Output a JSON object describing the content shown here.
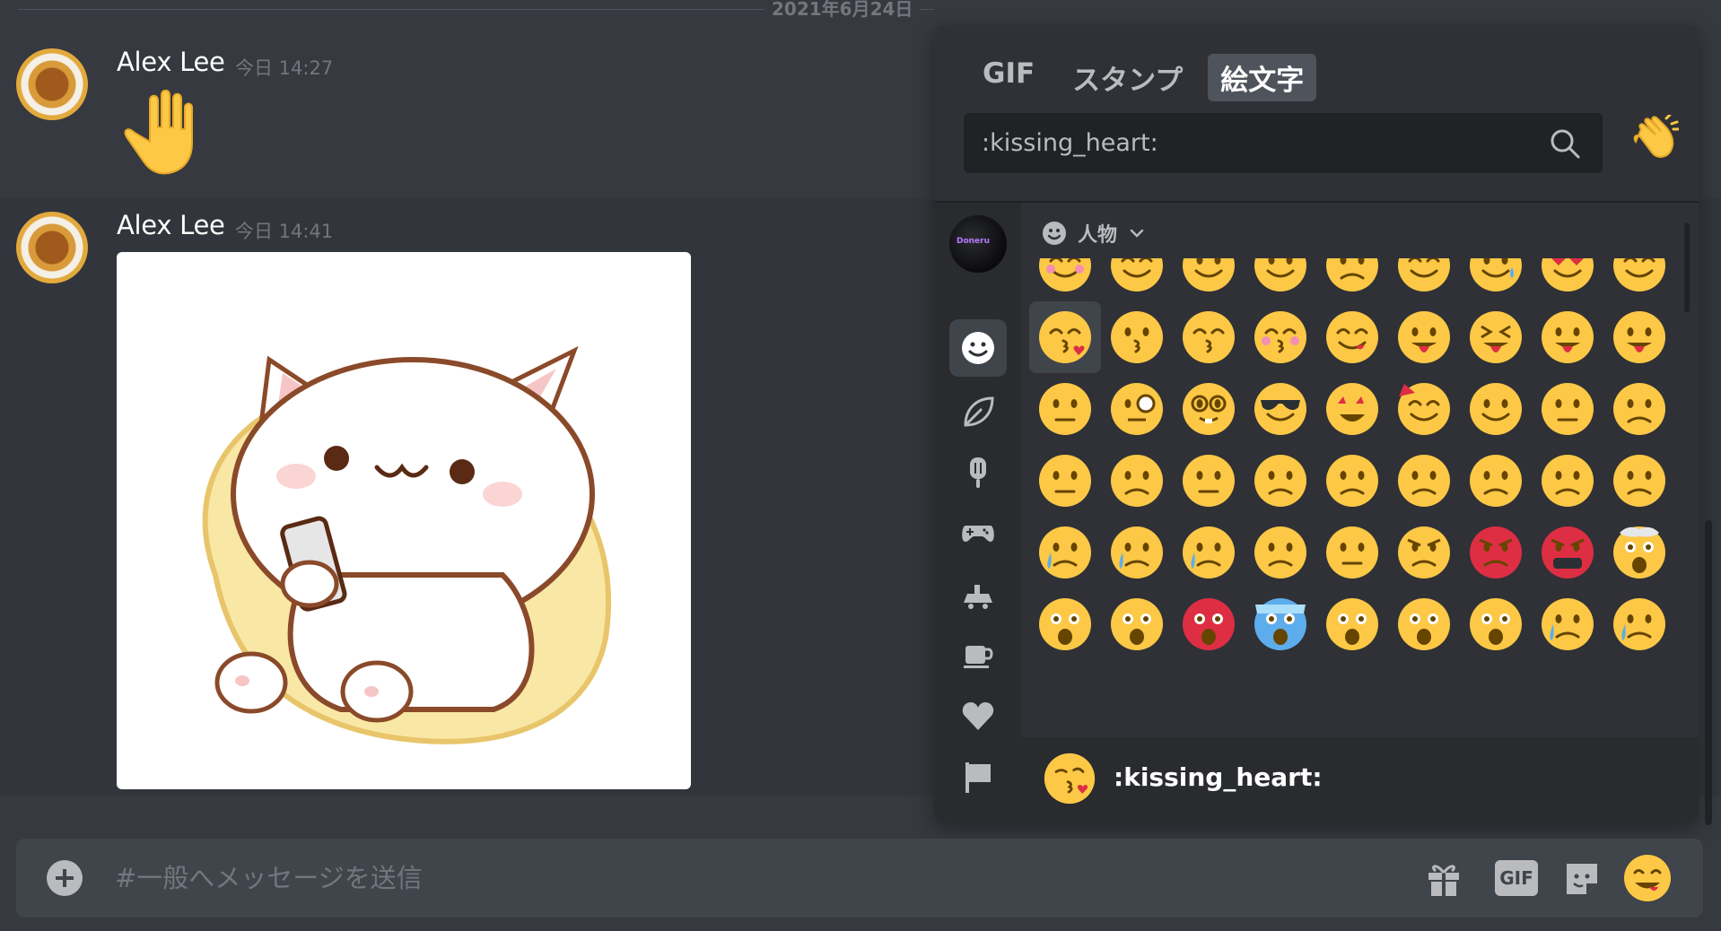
{
  "date_divider": "2021年6月24日",
  "messages": [
    {
      "author": "Alex Lee",
      "timestamp": "今日 14:27",
      "content": "wave-emoji"
    },
    {
      "author": "Alex Lee",
      "timestamp": "今日 14:41",
      "content": "sticker-image"
    }
  ],
  "picker": {
    "tabs": [
      "GIF",
      "スタンプ",
      "絵文字"
    ],
    "active_tab": "絵文字",
    "search": {
      "value": ":kissing_heart:",
      "placeholder": ""
    },
    "server_label": "Doneru",
    "category_label": "人物",
    "rail_icons": [
      "people-icon",
      "nature-icon",
      "food-icon",
      "activity-icon",
      "travel-icon",
      "objects-icon",
      "symbols-icon",
      "flags-icon"
    ],
    "preview_name": ":kissing_heart:"
  },
  "composer": {
    "placeholder": "#一般へメッセージを送信",
    "gif_label": "GIF"
  },
  "colors": {
    "background": "#36393f",
    "picker": "#2f3136",
    "rail": "#292b2f",
    "input": "#40444b",
    "emoji_yellow": "#fcc846"
  }
}
